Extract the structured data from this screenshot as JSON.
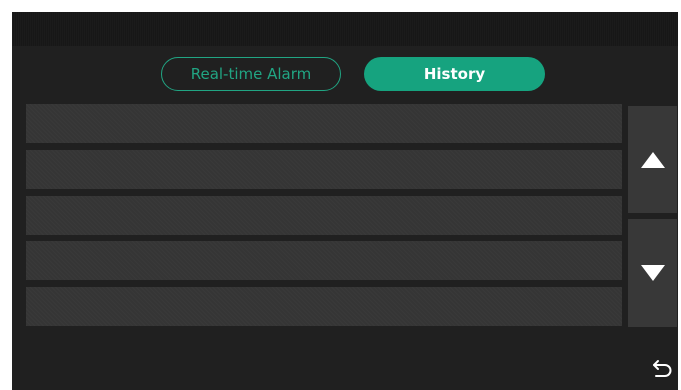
{
  "tabs": {
    "realtime_label": "Real-time Alarm",
    "history_label": "History",
    "active": "History"
  },
  "list": {
    "rows": [
      "",
      "",
      "",
      "",
      ""
    ]
  },
  "icons": {
    "scroll_up": "triangle-up-icon",
    "scroll_down": "triangle-down-icon",
    "back": "return-arrow-icon"
  },
  "colors": {
    "accent": "#16a37f",
    "screen_bg": "#202020",
    "row_bg": "#373737",
    "button_bg": "#383838"
  }
}
